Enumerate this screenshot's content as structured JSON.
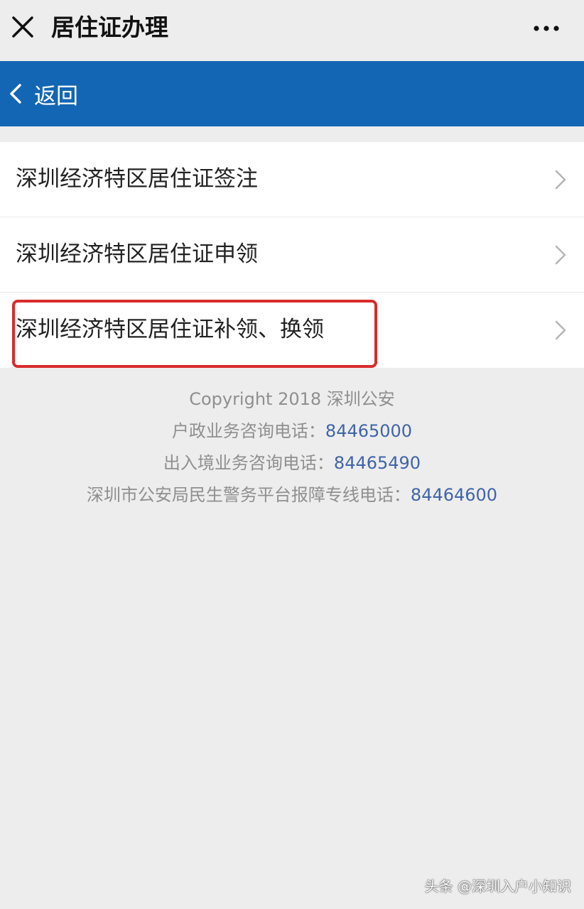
{
  "header": {
    "title": "居住证办理",
    "close_icon": "close-icon",
    "more_icon": "more-icon"
  },
  "nav": {
    "back_label": "返回",
    "back_icon": "chevron-left-icon",
    "background_color": "#1366b3"
  },
  "menu": {
    "items": [
      {
        "label": "深圳经济特区居住证签注"
      },
      {
        "label": "深圳经济特区居住证申领"
      },
      {
        "label": "深圳经济特区居住证补领、换领",
        "highlighted": true
      }
    ]
  },
  "footer": {
    "copyright": "Copyright 2018 深圳公安",
    "lines": [
      {
        "label": "户政业务咨询电话：",
        "phone": "84465000"
      },
      {
        "label": "出入境业务咨询电话：",
        "phone": "84465490"
      },
      {
        "label": "深圳市公安局民生警务平台报障专线电话：",
        "phone": "84464600"
      }
    ]
  },
  "watermark": "头条 @深圳入户小知识",
  "colors": {
    "highlight": "#d92b2b",
    "link": "#3f64a8"
  }
}
